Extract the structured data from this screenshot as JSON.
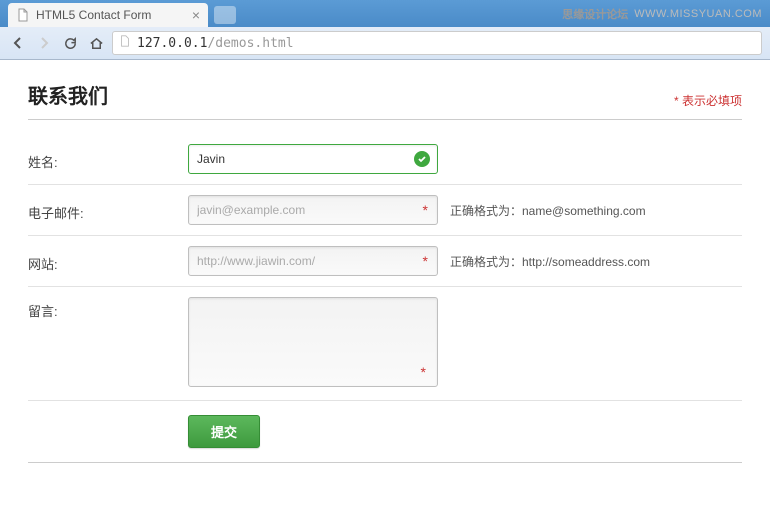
{
  "browser": {
    "tab_title": "HTML5 Contact Form",
    "url_host": "127.0.0.1",
    "url_path": "/demos.html"
  },
  "watermark": {
    "cn": "思缘设计论坛",
    "en": "WWW.MISSYUAN.COM"
  },
  "header": {
    "title": "联系我们",
    "required_note": "* 表示必填项"
  },
  "form": {
    "name": {
      "label": "姓名:",
      "value": "Javin"
    },
    "email": {
      "label": "电子邮件:",
      "placeholder": "javin@example.com",
      "hint": "正确格式为：name@something.com"
    },
    "website": {
      "label": "网站:",
      "placeholder": "http://www.jiawin.com/",
      "hint": "正确格式为：http://someaddress.com"
    },
    "message": {
      "label": "留言:"
    },
    "submit_label": "提交"
  }
}
